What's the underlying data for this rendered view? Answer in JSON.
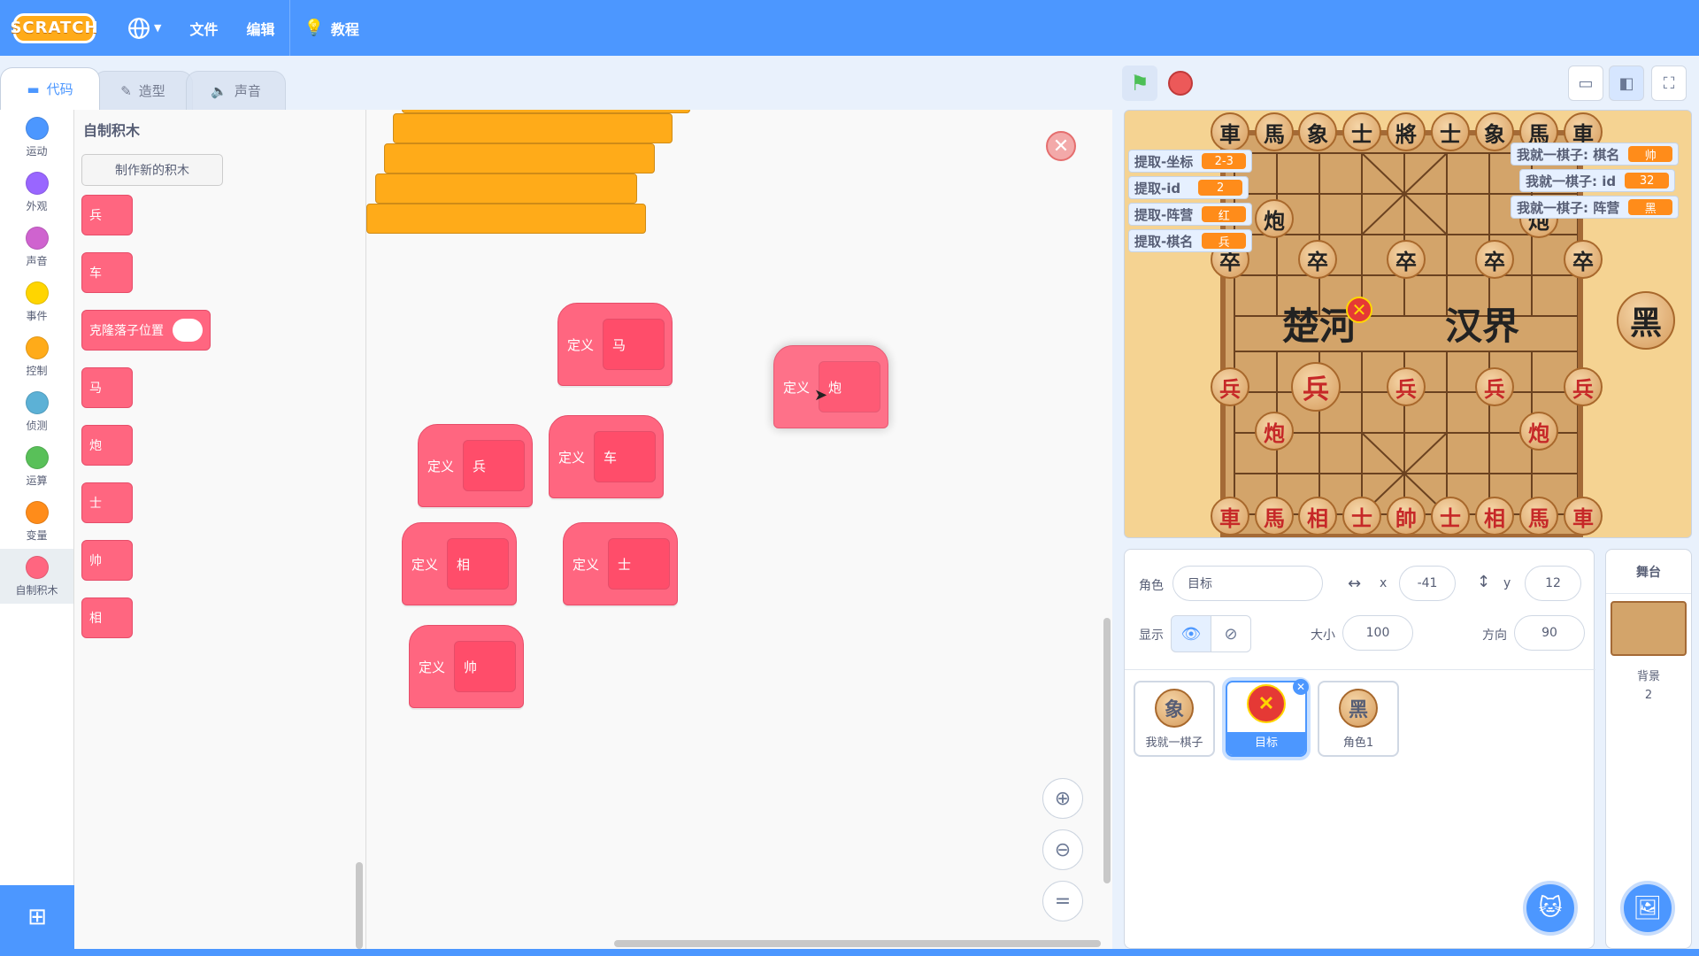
{
  "menubar": {
    "logo": "SCRATCH",
    "file": "文件",
    "edit": "编辑",
    "tutorials": "教程"
  },
  "tabs": {
    "code": "代码",
    "costumes": "造型",
    "sounds": "声音"
  },
  "categories": [
    {
      "label": "运动",
      "color": "#4c97ff"
    },
    {
      "label": "外观",
      "color": "#9966ff"
    },
    {
      "label": "声音",
      "color": "#cf63cf"
    },
    {
      "label": "事件",
      "color": "#ffd500"
    },
    {
      "label": "控制",
      "color": "#ffab19"
    },
    {
      "label": "侦测",
      "color": "#5cb1d6"
    },
    {
      "label": "运算",
      "color": "#59c059"
    },
    {
      "label": "变量",
      "color": "#ff8c1a"
    },
    {
      "label": "自制积木",
      "color": "#ff6680"
    }
  ],
  "palette": {
    "title": "自制积木",
    "make_block": "制作新的积木",
    "blocks": [
      "兵",
      "车",
      "克隆落子位置",
      "马",
      "炮",
      "士",
      "帅",
      "相"
    ]
  },
  "workspace": {
    "define_label": "定义",
    "defs": [
      "马",
      "兵",
      "车",
      "相",
      "士",
      "帅",
      "炮"
    ]
  },
  "stage": {
    "top_row": [
      "車",
      "馬",
      "象",
      "士",
      "將",
      "士",
      "象",
      "馬",
      "車"
    ],
    "bottom_row": [
      "車",
      "馬",
      "相",
      "士",
      "帥",
      "士",
      "相",
      "馬",
      "車"
    ],
    "black_soldiers": [
      "卒",
      "卒",
      "卒",
      "卒",
      "卒"
    ],
    "red_soldiers": [
      "兵",
      "兵",
      "兵",
      "兵",
      "兵"
    ],
    "black_cannon": [
      "炮",
      "炮"
    ],
    "red_cannon": [
      "炮",
      "炮"
    ],
    "river_left": "楚河",
    "river_right": "汉界",
    "black_button": "黑",
    "monitors_left": [
      {
        "label": "提取-坐标",
        "value": "2-3"
      },
      {
        "label": "提取-id",
        "value": "2"
      },
      {
        "label": "提取-阵营",
        "value": "红"
      },
      {
        "label": "提取-棋名",
        "value": "兵"
      }
    ],
    "monitors_right": [
      {
        "label": "我就一棋子: 棋名",
        "value": "帅"
      },
      {
        "label": "我就一棋子: id",
        "value": "32"
      },
      {
        "label": "我就一棋子: 阵营",
        "value": "黑"
      }
    ]
  },
  "sprite_info": {
    "sprite_label": "角色",
    "sprite_name": "目标",
    "x_label": "x",
    "x": "-41",
    "y_label": "y",
    "y": "12",
    "show_label": "显示",
    "size_label": "大小",
    "size": "100",
    "direction_label": "方向",
    "direction": "90"
  },
  "sprites": [
    {
      "name": "我就一棋子",
      "glyph": "象"
    },
    {
      "name": "目标",
      "glyph": "✕"
    },
    {
      "name": "角色1",
      "glyph": "黑"
    }
  ],
  "stage_panel": {
    "title": "舞台",
    "backdrop_label": "背景",
    "backdrop_count": "2"
  }
}
